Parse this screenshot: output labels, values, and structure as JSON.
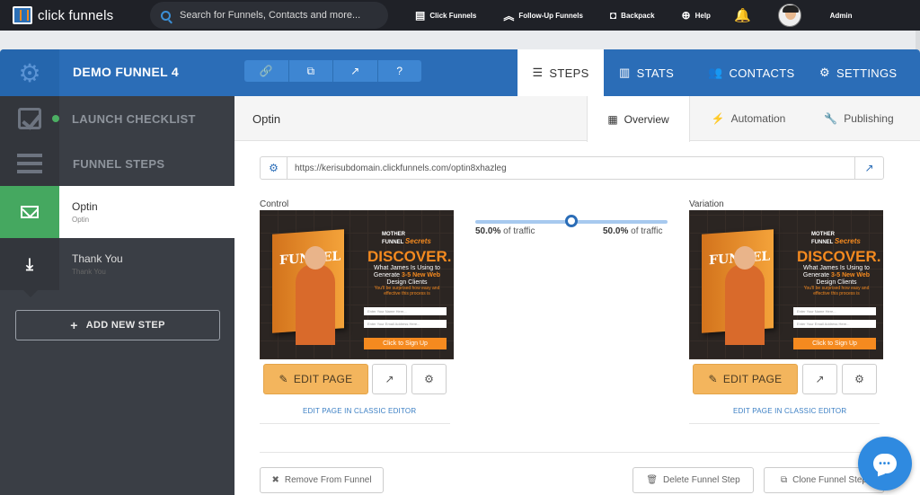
{
  "topbar": {
    "brand": "click funnels",
    "search_placeholder": "Search for Funnels, Contacts and more...",
    "nav": [
      {
        "icon": "funnel-icon",
        "label": "Click Funnels"
      },
      {
        "icon": "chevrons-up-icon",
        "label": "Follow-Up Funnels"
      },
      {
        "icon": "backpack-icon",
        "label": "Backpack"
      },
      {
        "icon": "life-ring-icon",
        "label": "Help"
      }
    ],
    "user_label": "Admin"
  },
  "header": {
    "funnel_name": "DEMO FUNNEL 4",
    "tabs": {
      "steps": "STEPS",
      "stats": "STATS",
      "contacts": "CONTACTS",
      "settings": "SETTINGS"
    }
  },
  "sidebar": {
    "launch_checklist": "LAUNCH CHECKLIST",
    "funnel_steps": "FUNNEL STEPS",
    "steps": [
      {
        "name": "Optin",
        "sub": "Optin"
      },
      {
        "name": "Thank You",
        "sub": "Thank You"
      }
    ],
    "add_step": "ADD NEW STEP"
  },
  "main": {
    "title": "Optin",
    "tabs": {
      "overview": "Overview",
      "automation": "Automation",
      "publishing": "Publishing"
    },
    "url": "https://kerisubdomain.clickfunnels.com/optin8xhazleg",
    "control_label": "Control",
    "variation_label": "Variation",
    "traffic_left": "50.0%",
    "traffic_right": "50.0%",
    "traffic_suffix": "of traffic",
    "traffic_split": 0.5,
    "edit_page": "EDIT PAGE",
    "classic_editor": "EDIT PAGE IN CLASSIC EDITOR",
    "remove": "Remove From Funnel",
    "delete": "Delete Funnel Step",
    "clone": "Clone Funnel Step"
  },
  "preview": {
    "logo_top": "MOTHER",
    "logo_bottom": "FUNNEL",
    "logo_script": "Secrets",
    "book_title": "FUNNEL",
    "headline": "DISCOVER.",
    "sub_1": "What James Is Using to",
    "sub_2a": "Generate ",
    "sub_2b": "3-5 New Web",
    "sub_3": "Design Clients",
    "small_1": "You'll be surprised how easy and",
    "small_2": "effective this process is",
    "field_name": "Enter Your Name Here...",
    "field_email": "Enter Your Email Address Here...",
    "cta": "Click to Sign Up"
  },
  "colors": {
    "topbar": "#1f2127",
    "header_blue": "#2b6db7",
    "sidebar": "#3a3e45",
    "step_green": "#45a860",
    "edit_orange": "#f3b55d",
    "link_blue": "#3b7fc4"
  }
}
